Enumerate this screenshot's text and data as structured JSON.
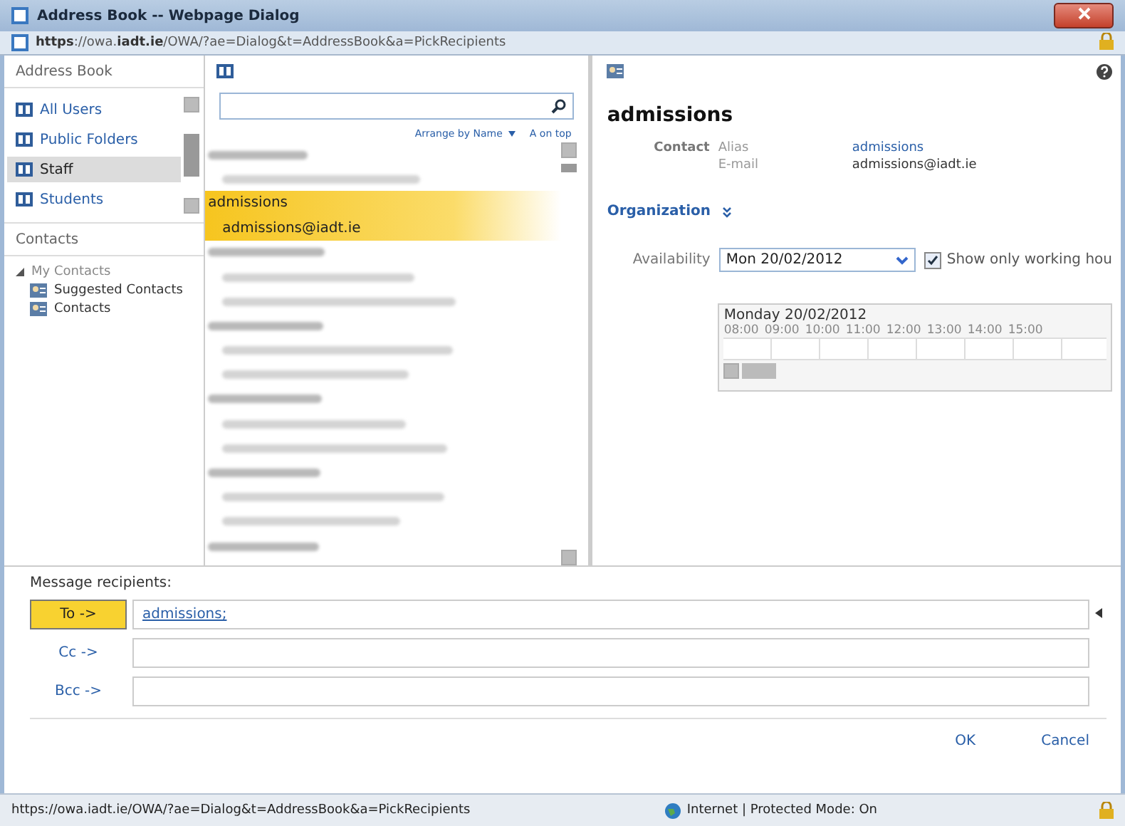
{
  "window": {
    "title": "Address Book -- Webpage Dialog",
    "url_host": "https://owa.",
    "url_domain": "iadt.ie",
    "url_path": "/OWA/?ae=Dialog&t=AddressBook&a=PickRecipients"
  },
  "sidebar": {
    "title": "Address Book",
    "items": [
      {
        "label": "All Users",
        "selected": false
      },
      {
        "label": "Public Folders",
        "selected": false
      },
      {
        "label": "Staff",
        "selected": true
      },
      {
        "label": "Students",
        "selected": false
      }
    ],
    "contacts_title": "Contacts",
    "tree": [
      {
        "label": "My Contacts",
        "expanded": true,
        "children": [
          {
            "label": "Suggested Contacts"
          },
          {
            "label": "Contacts"
          }
        ]
      }
    ]
  },
  "list": {
    "arrange": "Arrange by Name",
    "order": "A on top",
    "rows": [
      {
        "kind": "blurred-heading",
        "selected": false
      },
      {
        "kind": "blurred-detail",
        "selected": false
      },
      {
        "kind": "heading",
        "text": "admissions",
        "selected": true
      },
      {
        "kind": "detail",
        "text": "admissions@iadt.ie",
        "selected": true
      },
      {
        "kind": "blurred-heading",
        "selected": false
      },
      {
        "kind": "blurred-detail",
        "selected": false
      },
      {
        "kind": "blurred-detail",
        "selected": false
      },
      {
        "kind": "blurred-heading",
        "selected": false
      },
      {
        "kind": "blurred-detail",
        "selected": false
      },
      {
        "kind": "blurred-detail",
        "selected": false
      },
      {
        "kind": "blurred-heading",
        "selected": false
      },
      {
        "kind": "blurred-detail",
        "selected": false
      },
      {
        "kind": "blurred-detail",
        "selected": false
      },
      {
        "kind": "blurred-heading",
        "selected": false
      },
      {
        "kind": "blurred-detail",
        "selected": false
      },
      {
        "kind": "blurred-detail",
        "selected": false
      },
      {
        "kind": "blurred-heading",
        "selected": false
      }
    ]
  },
  "details": {
    "name": "admissions",
    "contact_label": "Contact",
    "fields": [
      {
        "label": "Alias",
        "value": "admissions",
        "link": true
      },
      {
        "label": "E-mail",
        "value": "admissions@iadt.ie",
        "link": false
      }
    ],
    "organization": "Organization",
    "availability_label": "Availability",
    "date": "Mon 20/02/2012",
    "working_hours": {
      "label": "Show only working hou",
      "checked": true
    },
    "timeline": {
      "day": "Monday 20/02/2012",
      "hours": [
        "08:00",
        "09:00",
        "10:00",
        "11:00",
        "12:00",
        "13:00",
        "14:00",
        "15:00"
      ]
    }
  },
  "recipients": {
    "title": "Message recipients:",
    "rows": [
      {
        "label": "To ->",
        "value": "admissions;",
        "selected": true
      },
      {
        "label": "Cc ->",
        "selected": false
      },
      {
        "label": "Bcc ->",
        "selected": false
      }
    ]
  },
  "buttons": [
    "OK",
    "Cancel"
  ],
  "status_bar": {
    "url": "https://owa.iadt.ie/OWA/?ae=Dialog&t=AddressBook&a=PickRecipients",
    "zone": "Internet | Protected Mode: On"
  }
}
